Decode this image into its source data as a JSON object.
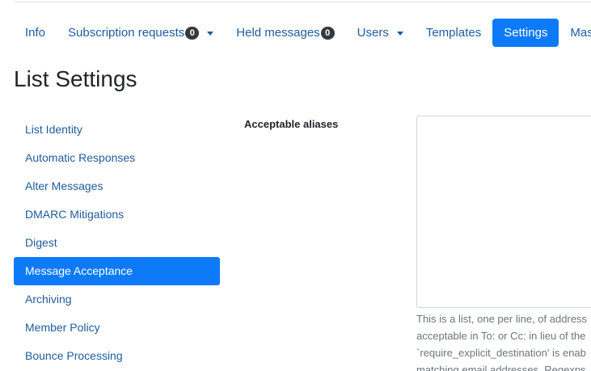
{
  "nav": {
    "items": [
      {
        "label": "Info"
      },
      {
        "label": "Subscription requests",
        "badge": "0"
      },
      {
        "label": "Held messages",
        "badge": "0"
      },
      {
        "label": "Users"
      },
      {
        "label": "Templates"
      },
      {
        "label": "Settings",
        "active": true
      },
      {
        "label": "Mass operat"
      }
    ]
  },
  "page": {
    "title": "List Settings"
  },
  "sidebar": {
    "items": [
      {
        "label": "List Identity"
      },
      {
        "label": "Automatic Responses"
      },
      {
        "label": "Alter Messages"
      },
      {
        "label": "DMARC Mitigations"
      },
      {
        "label": "Digest"
      },
      {
        "label": "Message Acceptance",
        "active": true
      },
      {
        "label": "Archiving"
      },
      {
        "label": "Member Policy"
      },
      {
        "label": "Bounce Processing"
      }
    ]
  },
  "form": {
    "aliases_label": "Acceptable aliases",
    "aliases_value": "",
    "help_lines": [
      "This is a list, one per line, of address",
      "acceptable in To: or Cc: in lieu of the",
      "`require_explicit_destination' is enab",
      "matching email addresses. Regexps"
    ]
  },
  "colors": {
    "accent": "#0d7bf9",
    "link": "#1f5b9b",
    "badge": "#343a40"
  }
}
